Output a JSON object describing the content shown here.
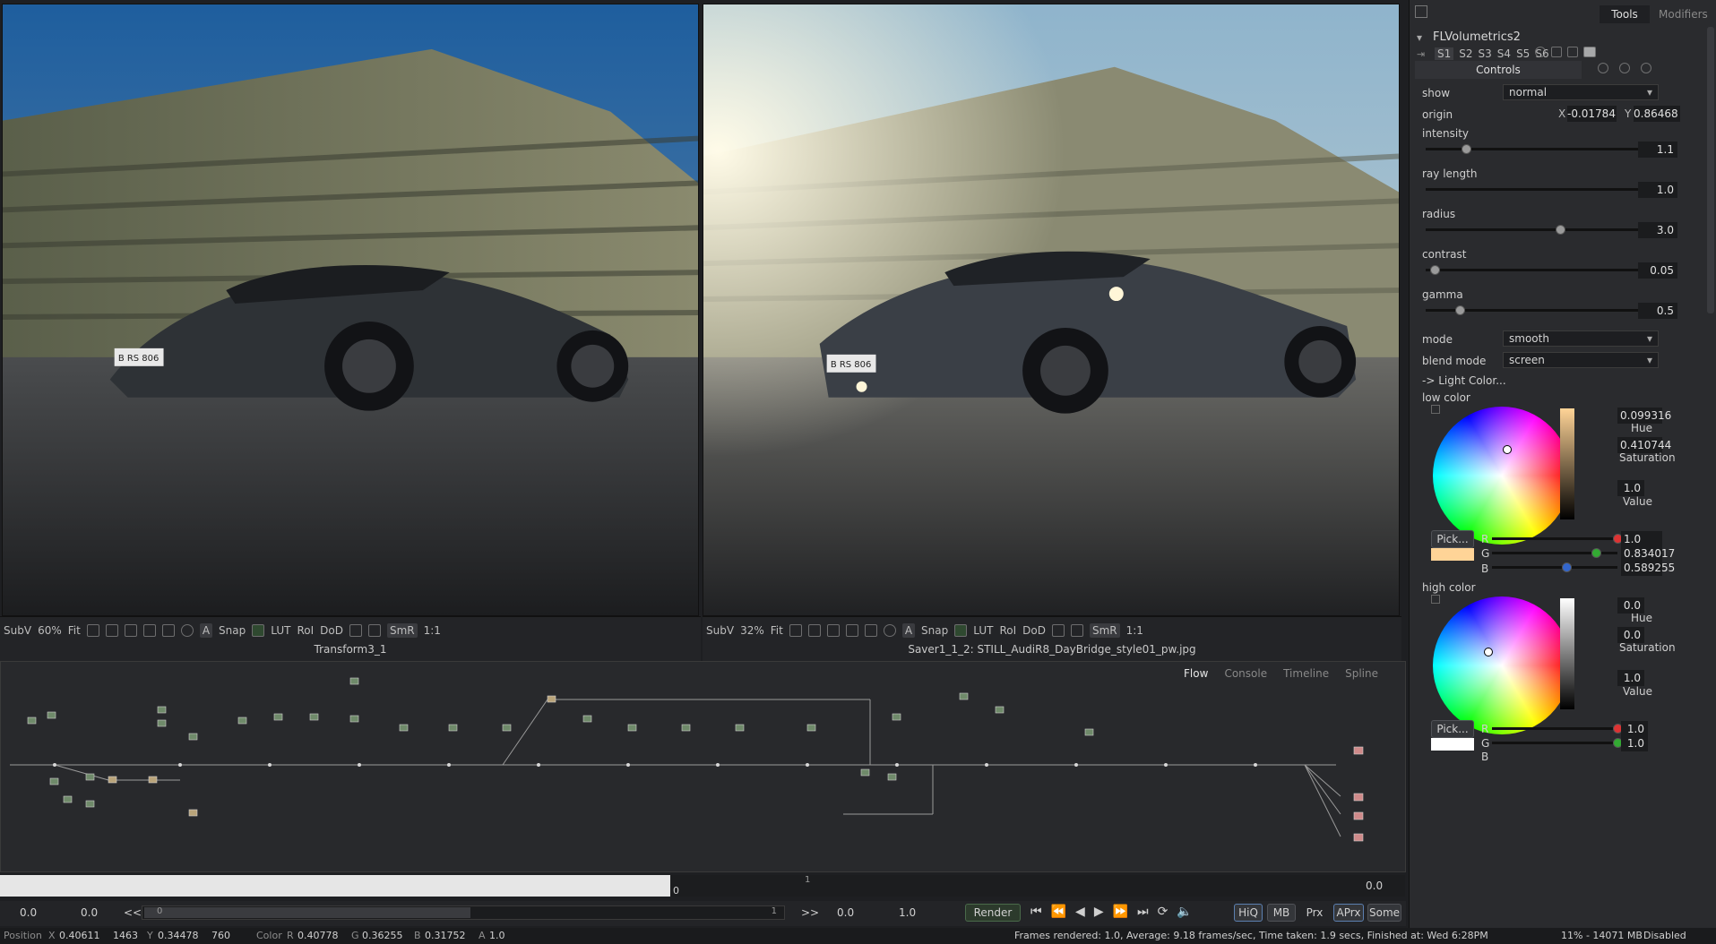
{
  "viewers": {
    "left": {
      "subview": "SubV",
      "zoom": "60%",
      "fit": "Fit",
      "snap": "Snap",
      "lut": "LUT",
      "roi": "RoI",
      "dod": "DoD",
      "smr": "SmR",
      "ratio": "1:1",
      "title": "Transform3_1",
      "plate": "B RS 806"
    },
    "right": {
      "subview": "SubV",
      "zoom": "32%",
      "fit": "Fit",
      "snap": "Snap",
      "lut": "LUT",
      "roi": "RoI",
      "dod": "DoD",
      "smr": "SmR",
      "ratio": "1:1",
      "title": "Saver1_1_2: STILL_AudiR8_DayBridge_style01_pw.jpg",
      "plate": "B RS 806"
    }
  },
  "flow": {
    "tabs": [
      "Flow",
      "Console",
      "Timeline",
      "Spline"
    ],
    "active": "Flow"
  },
  "panel": {
    "tabs": {
      "tools": "Tools",
      "modifiers": "Modifiers"
    },
    "tool_name": "FLVolumetrics2",
    "versions": [
      "S1",
      "S2",
      "S3",
      "S4",
      "S5",
      "S6"
    ],
    "section": "Controls",
    "show": {
      "label": "show",
      "value": "normal"
    },
    "origin": {
      "label": "origin",
      "x_label": "X",
      "x": "-0.01784",
      "y_label": "Y",
      "y": "0.86468"
    },
    "sliders": [
      {
        "label": "intensity",
        "value": "1.1",
        "pos": 0.18
      },
      {
        "label": "ray length",
        "value": "1.0",
        "pos": 1.0
      },
      {
        "label": "radius",
        "value": "3.0",
        "pos": 0.6
      },
      {
        "label": "contrast",
        "value": "0.05",
        "pos": 0.04
      },
      {
        "label": "gamma",
        "value": "0.5",
        "pos": 0.15
      }
    ],
    "mode": {
      "label": "mode",
      "value": "smooth"
    },
    "blend": {
      "label": "blend mode",
      "value": "screen"
    },
    "light_color": "-> Light Color...",
    "low_color": {
      "label": "low color",
      "hue": "0.099316",
      "hue_label": "Hue",
      "sat": "0.410744",
      "sat_label": "Saturation",
      "val": "1.0",
      "val_label": "Value",
      "pick": "Pick...",
      "r_label": "R",
      "r": "1.0",
      "g_label": "G",
      "g": "0.834017",
      "b_label": "B",
      "b": "0.589255",
      "swatch": "#ffd497"
    },
    "high_color": {
      "label": "high color",
      "hue": "0.0",
      "hue_label": "Hue",
      "sat": "0.0",
      "sat_label": "Saturation",
      "val": "1.0",
      "val_label": "Value",
      "pick": "Pick...",
      "r_label": "R",
      "r": "1.0",
      "g_label": "G",
      "g": "1.0",
      "b_label": "B",
      "swatch": "#ffffff"
    }
  },
  "timeline": {
    "left_start": "0",
    "right_value": "0.0",
    "tick": "1",
    "start1": "0.0",
    "start2": "0.0",
    "back": "<<",
    "scrub": "0",
    "scrub_end": "1",
    "fwd": ">>",
    "end1": "0.0",
    "end2": "1.0",
    "render": "Render",
    "hiq": "HiQ",
    "mb": "MB",
    "prx": "Prx",
    "aprx": "APrx",
    "some": "Some"
  },
  "status": {
    "position": "Position",
    "x_label": "X",
    "x": "0.40611",
    "x_px": "1463",
    "y_label": "Y",
    "y": "0.34478",
    "y_px": "760",
    "color_label": "Color",
    "r_label": "R",
    "r": "0.40778",
    "g_label": "G",
    "g": "0.36255",
    "b_label": "B",
    "b": "0.31752",
    "a_label": "A",
    "a": "1.0",
    "message": "Frames rendered: 1.0,  Average: 9.18 frames/sec,  Time taken: 1.9 secs,  Finished at: Wed 6:28PM",
    "memory": "11% - 14071 MB",
    "state": "Disabled"
  }
}
